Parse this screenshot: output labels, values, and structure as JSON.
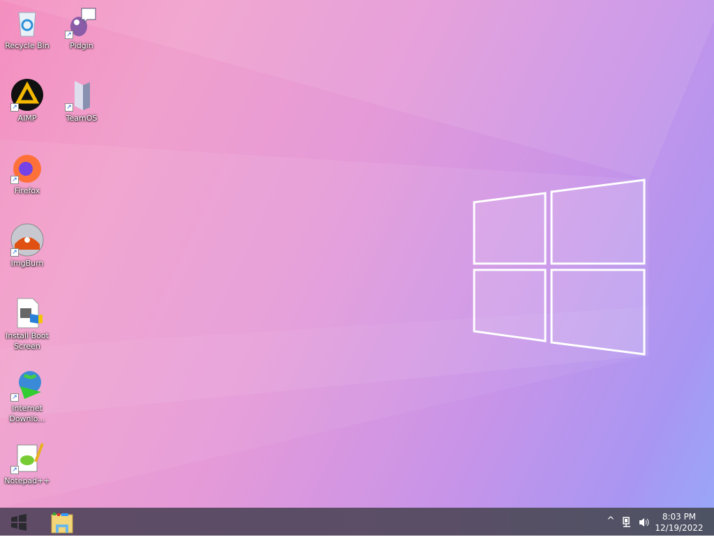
{
  "desktop": {
    "icons": [
      {
        "label": "Recycle Bin",
        "icon": "recycle-bin-icon"
      },
      {
        "label": "Pidgin",
        "icon": "pidgin-icon"
      },
      {
        "label": "AIMP",
        "icon": "aimp-icon"
      },
      {
        "label": "TeamOS",
        "icon": "teamos-icon"
      },
      {
        "label": "Firefox",
        "icon": "firefox-icon"
      },
      {
        "label": "ImgBurn",
        "icon": "imgburn-icon"
      },
      {
        "label": "Install Boot Screen",
        "icon": "install-boot-screen-icon"
      },
      {
        "label": "Internet Downlo...",
        "icon": "internet-download-manager-icon"
      },
      {
        "label": "Notepad++",
        "icon": "notepadpp-icon"
      }
    ]
  },
  "taskbar": {
    "time": "8:03 PM",
    "date": "12/19/2022",
    "tray_chevron": "^",
    "shortcut_arrow": "↗"
  }
}
